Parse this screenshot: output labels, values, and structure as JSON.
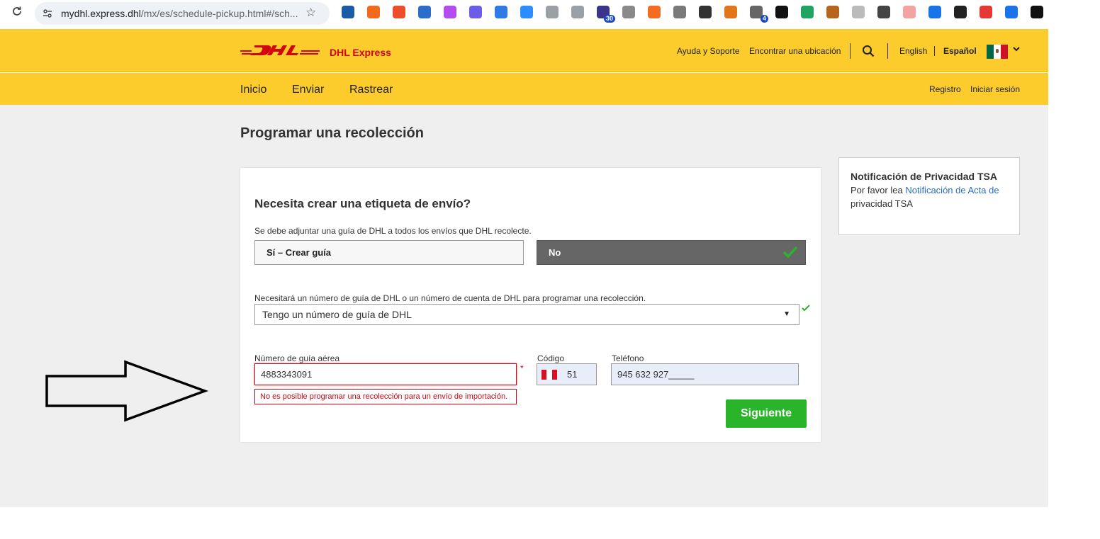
{
  "browser": {
    "url_host": "mydhl.express.dhl",
    "url_path": "/mx/es/schedule-pickup.html#/sch...",
    "extensions": [
      {
        "name": "extension-icon",
        "color": "#1c5aa6"
      },
      {
        "name": "extension-icon",
        "color": "#f26a1b"
      },
      {
        "name": "extension-icon",
        "color": "#ee4d2d"
      },
      {
        "name": "extension-icon",
        "color": "#2a6dcb"
      },
      {
        "name": "extension-icon",
        "color": "#b44cf0"
      },
      {
        "name": "extension-icon",
        "color": "#6c5ce7"
      },
      {
        "name": "extension-icon",
        "color": "#2f7ae5"
      },
      {
        "name": "extension-icon",
        "color": "#2d8cff"
      },
      {
        "name": "extension-icon",
        "color": "#9aa0a6"
      },
      {
        "name": "extension-icon",
        "color": "#9aa0a6"
      },
      {
        "name": "extension-icon",
        "color": "#3c3489",
        "badge": "30"
      },
      {
        "name": "extension-icon",
        "color": "#8a8a8a"
      },
      {
        "name": "extension-icon",
        "color": "#f36c21"
      },
      {
        "name": "extension-icon",
        "color": "#7a7a7a"
      },
      {
        "name": "extension-icon",
        "color": "#333333"
      },
      {
        "name": "extension-icon",
        "color": "#e2761b"
      },
      {
        "name": "extension-icon",
        "color": "#666666",
        "badge": "4"
      },
      {
        "name": "extension-icon",
        "color": "#111111"
      },
      {
        "name": "extension-icon",
        "color": "#1fa463"
      },
      {
        "name": "extension-icon",
        "color": "#b5651d"
      },
      {
        "name": "extension-icon",
        "color": "#bbbbbb"
      },
      {
        "name": "extension-icon",
        "color": "#444444"
      },
      {
        "name": "extension-icon",
        "color": "#f4a3a3"
      },
      {
        "name": "extension-icon",
        "color": "#1a73e8"
      },
      {
        "name": "extension-icon",
        "color": "#222222"
      },
      {
        "name": "extension-icon",
        "color": "#e53935"
      },
      {
        "name": "extension-icon",
        "color": "#1a73e8"
      },
      {
        "name": "extension-icon",
        "color": "#111111"
      }
    ]
  },
  "header": {
    "brand": "DHL Express",
    "help_link": "Ayuda y Soporte",
    "location_link": "Encontrar una ubicación",
    "lang_en": "English",
    "lang_es": "Español"
  },
  "nav": {
    "items": [
      "Inicio",
      "Enviar",
      "Rastrear"
    ],
    "register": "Registro",
    "login": "Iniciar sesión"
  },
  "page": {
    "title": "Programar una recolección"
  },
  "form": {
    "heading": "Necesita crear una etiqueta de envío?",
    "note": "Se debe adjuntar una guía de DHL a todos los envíos que DHL recolecte.",
    "yes_label": "Sí – Crear guía",
    "no_label": "No",
    "select_label": "Necesitará un número de guía de DHL o un número de cuenta de DHL para programar una recolección.",
    "select_value": "Tengo un número de guía de DHL",
    "awb_label": "Número de guía aérea",
    "awb_value": "4883343091",
    "required_mark": "*",
    "error_text": "No es posible programar una recolección para un envío de importación.",
    "code_label": "Código",
    "code_value": "51",
    "phone_label": "Teléfono",
    "phone_value": "945 632 927_____",
    "next_button": "Siguiente"
  },
  "privacy": {
    "title": "Notificación de Privacidad TSA",
    "text_prefix": "Por favor lea",
    "link_text": "Notificación de Acta de",
    "text_suffix": "privacidad TSA"
  },
  "colors": {
    "dhl_yellow": "#fccc2d",
    "dhl_red": "#d40511",
    "success_green": "#2ab42a",
    "selected_gray": "#666666"
  }
}
